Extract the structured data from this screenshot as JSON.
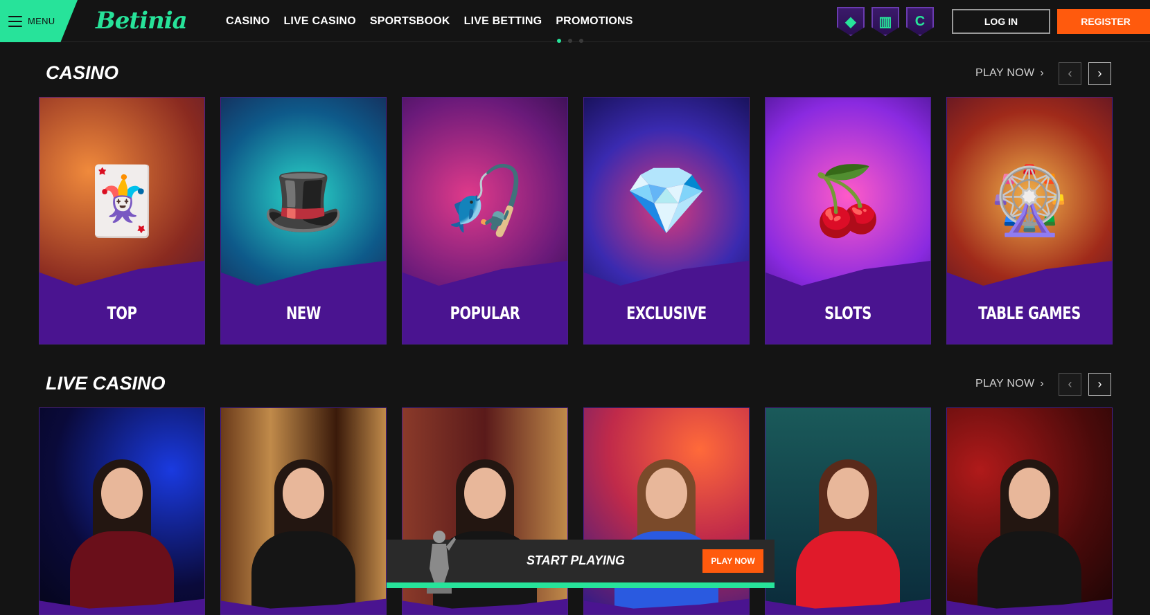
{
  "header": {
    "menu_label": "MENU",
    "logo_text": "Betinia",
    "nav": [
      "CASINO",
      "LIVE CASINO",
      "SPORTSBOOK",
      "LIVE BETTING",
      "PROMOTIONS"
    ],
    "login_label": "LOG IN",
    "register_label": "REGISTER"
  },
  "casino": {
    "title": "CASINO",
    "play_now": "PLAY NOW",
    "cards": [
      "TOP",
      "NEW",
      "POPULAR",
      "EXCLUSIVE",
      "SLOTS",
      "TABLE GAMES"
    ]
  },
  "live_casino": {
    "title": "LIVE CASINO",
    "play_now": "PLAY NOW"
  },
  "sticky_bar": {
    "title": "START PLAYING",
    "cta": "PLAY NOW"
  },
  "colors": {
    "brand_green": "#27e39a",
    "accent_orange": "#ff5a0d",
    "card_purple": "#4a1490"
  }
}
